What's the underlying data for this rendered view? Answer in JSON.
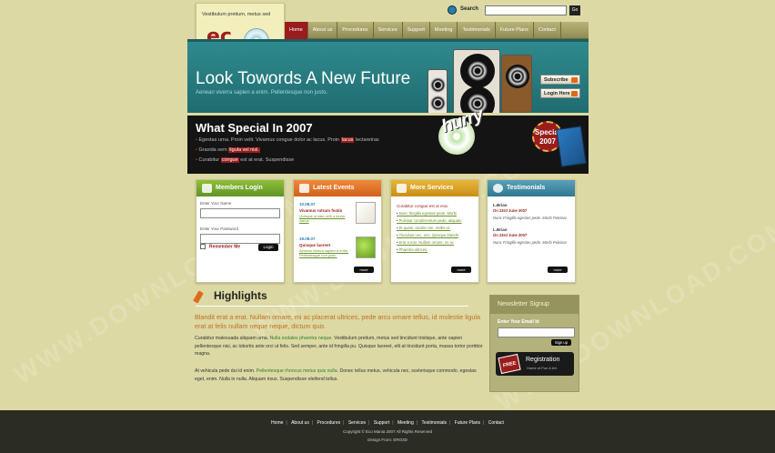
{
  "header": {
    "search_label": "Search",
    "search_value": "",
    "go_label": "Go",
    "tagline": "Vestibulum pretium, metus sed",
    "logo_mark": "ec",
    "logo_sub": "mania"
  },
  "nav": {
    "items": [
      "Home",
      "About us",
      "Procedures",
      "Services",
      "Support",
      "Meeting",
      "Testimonials",
      "Future Plans",
      "Contact"
    ]
  },
  "hero": {
    "title": "Look Towords A New Future",
    "subtitle": "Aenean viverra sapien a enim. Pellentesque non justo.",
    "subscribe_label": "Subscribe",
    "login_label": "Login Here"
  },
  "special": {
    "title": "What Special In 2007",
    "items": [
      {
        "pre": "Egestas urna.  Proin velit.  Vivamus congue dolor ac lacus.  Proin",
        "hl": "lacus",
        "post": "lectaretras"
      },
      {
        "pre": "Gravida sem",
        "hl": "ligula vel nisl.",
        "post": ""
      },
      {
        "pre": "Curabitur",
        "hl": "congue",
        "post": "est at erat.  Suspendisse"
      }
    ],
    "hurry": "hurry",
    "badge": "Special 2007"
  },
  "members": {
    "title": "Members Login",
    "name_label": "Enter Your Name",
    "password_label": "Enter Your Password",
    "remember_label": "Remember Me",
    "login_button": "Login"
  },
  "events": {
    "title": "Latest Events",
    "items": [
      {
        "date": "10.08.07",
        "title": "Vivamus rutrum festin",
        "excerpt": "Quisque ornare velit a lorem varius"
      },
      {
        "date": "19.08.07",
        "title": "Quisque laoreet",
        "excerpt": "Aenean viverra sapien a enim. Pellentesque non justo."
      }
    ],
    "more_label": "more"
  },
  "services": {
    "title": "More Services",
    "intro": "Curabitur congue est at erat.",
    "items": [
      "Nunc fringilla egestas pede. Morbi",
      "Pulvinar condimentum pede, aliquam",
      "Et quam, iaculis non, mollis et.",
      "Tincidunt nec, orci. Quisque blandit",
      "Erat a mar. Nullam ornare, mi ac",
      "Pharetra ultrices."
    ],
    "more_label": "more"
  },
  "testimonials": {
    "title": "Testimonials",
    "items": [
      {
        "name": "L.Brian",
        "date": "On 23rd June 2007",
        "quote": "Nunc Fringilla egestas pede. Morbi Pulvinar"
      },
      {
        "name": "L.Brian",
        "date": "On 23rd June 2007",
        "quote": "Nunc Fringilla egestas pede. Morbi Pulvinar"
      }
    ],
    "more_label": "more"
  },
  "highlights": {
    "title": "Highlights",
    "lead": "Blandit erat a erat.  Nullam ornare, mi ac placerat ultrices, pede arcu ornare tellus, id molestie ligula erat at felis nullam neque neque, dictum quis",
    "para1_a": "Curabitur malesuada aliquam urna.",
    "para1_link": "Nulla sodales pharetra neque.",
    "para1_b": "Vestibulum pretium, metus sed tincidunt tristique, ante sapien pellentesque nisi, ac lobortis ante orci ut felis. Sed semper, ante id fringilla pu. Quisque laoreet, elit at tincidunt porta, massa tortor porttitor magna.",
    "para2_a": "At vehicula pede dui id enim.",
    "para2_link": "Pellentesque rhoncus metus quis nulla.",
    "para2_b": "Donec tellus metus, vehicula nec, scelerisque commodo, egestas eget, enim. Nulla in nulla. Aliquam risus. Suspendisse eleifend tellus."
  },
  "newsletter": {
    "title": "Newsletter Signup",
    "email_label": "Enter Your Email Id",
    "email_value": "",
    "signup_label": "Sign up",
    "free": "FREE",
    "reg_title": "Registration",
    "reg_sub": "Home of Fun & Art"
  },
  "footer": {
    "links": [
      "Home",
      "About us",
      "Procedures",
      "Services",
      "Support",
      "Meeting",
      "Testimonials",
      "Future Plans",
      "Contact"
    ],
    "copyright": "Copyright © Eco Mania 2007 All Rights Reserved",
    "design": "Design From: ERO3D"
  },
  "watermark": "WWW.DOWNLOAD.COM"
}
